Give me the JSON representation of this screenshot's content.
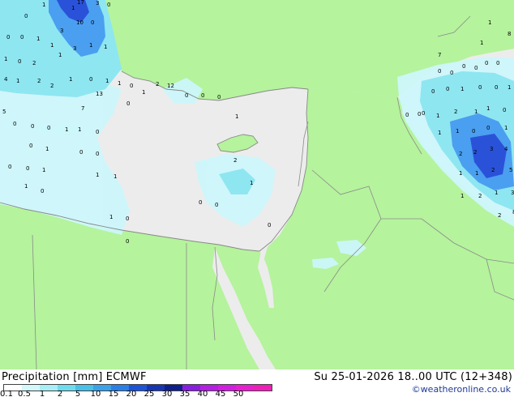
{
  "map": {
    "title_left": "Precipitation [mm]  ECMWF",
    "title_right": "Su 25-01-2026 18..00 UTC (12+348)",
    "credit": "©weatheronline.co.uk",
    "colors": {
      "land": "#b5f39d",
      "land_dry": "#ececec",
      "sea_light": "#cdf7fb",
      "sea_mid": "#8ee6f1",
      "rain_mid": "#5bcfe6",
      "rain_blue": "#4a9ff0",
      "rain_dark": "#2a52d8",
      "border": "#8a8a8a",
      "coast": "#888888"
    },
    "legend": {
      "labels": [
        "0.1",
        "0.5",
        "1",
        "2",
        "5",
        "10",
        "15",
        "20",
        "25",
        "30",
        "35",
        "40",
        "45",
        "50"
      ],
      "colors": [
        "#ffffff",
        "#d2f8fb",
        "#a8eef6",
        "#6fdbee",
        "#48c0e8",
        "#3aa1ea",
        "#2a7ee8",
        "#1e53d9",
        "#1835b0",
        "#0f1f8a",
        "#8a1ee0",
        "#b51ee3",
        "#d21ee0",
        "#e81ed0",
        "#f01eb8"
      ]
    },
    "point_values": [
      "0",
      "1",
      "1",
      "0",
      "3",
      "10",
      "17",
      "3",
      "0",
      "0",
      "0",
      "1",
      "1",
      "1",
      "3",
      "1",
      "0",
      "2",
      "1",
      "1",
      "4",
      "1",
      "2",
      "2",
      "1",
      "0",
      "1",
      "1",
      "0",
      "5",
      "0",
      "0",
      "0",
      "1",
      "1",
      "0",
      "0",
      "1",
      "0",
      "0",
      "0",
      "0",
      "1",
      "1",
      "1",
      "1",
      "0",
      "1",
      "0",
      "0",
      "0",
      "0",
      "1",
      "2",
      "1",
      "0",
      "0",
      "0",
      "0",
      "0",
      "0",
      "0",
      "0",
      "0",
      "0",
      "0",
      "0",
      "0",
      "0",
      "1",
      "0",
      "0",
      "1",
      "0",
      "1",
      "2",
      "1",
      "1",
      "0",
      "1",
      "1",
      "0",
      "0",
      "1",
      "2",
      "2",
      "3",
      "4",
      "1",
      "1",
      "2",
      "5",
      "1",
      "2",
      "1",
      "3",
      "2",
      "8",
      "7",
      "1",
      "1",
      "8",
      "7",
      "13",
      "0",
      "1",
      "2",
      "12",
      "0",
      "3",
      "3"
    ]
  }
}
